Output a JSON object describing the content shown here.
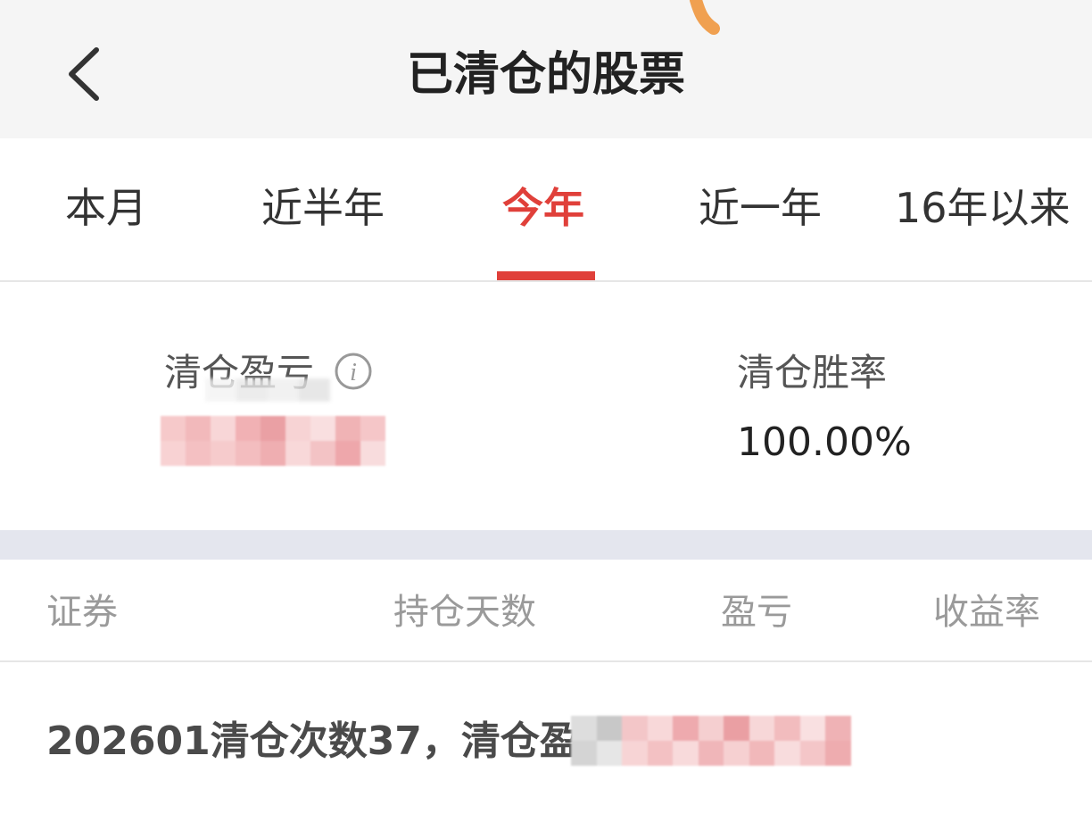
{
  "header": {
    "title": "已清仓的股票",
    "back_icon": "chevron-left-icon"
  },
  "tabs": [
    {
      "label": "本月",
      "active": false
    },
    {
      "label": "近半年",
      "active": false
    },
    {
      "label": "今年",
      "active": true
    },
    {
      "label": "近一年",
      "active": false
    },
    {
      "label": "16年以来",
      "active": false
    }
  ],
  "summary": {
    "pnl_label": "清仓盈亏",
    "pnl_info_icon": "info-icon",
    "win_rate_label": "清仓胜率",
    "win_rate_value": "100.00%"
  },
  "table": {
    "columns": [
      "证券",
      "持仓天数",
      "盈亏",
      "收益率"
    ]
  },
  "records": [
    {
      "text": "202601清仓次数37，清仓盈利"
    }
  ],
  "colors": {
    "accent": "#e0403a",
    "header_bg": "#f5f5f5",
    "band": "#e4e6ee"
  }
}
